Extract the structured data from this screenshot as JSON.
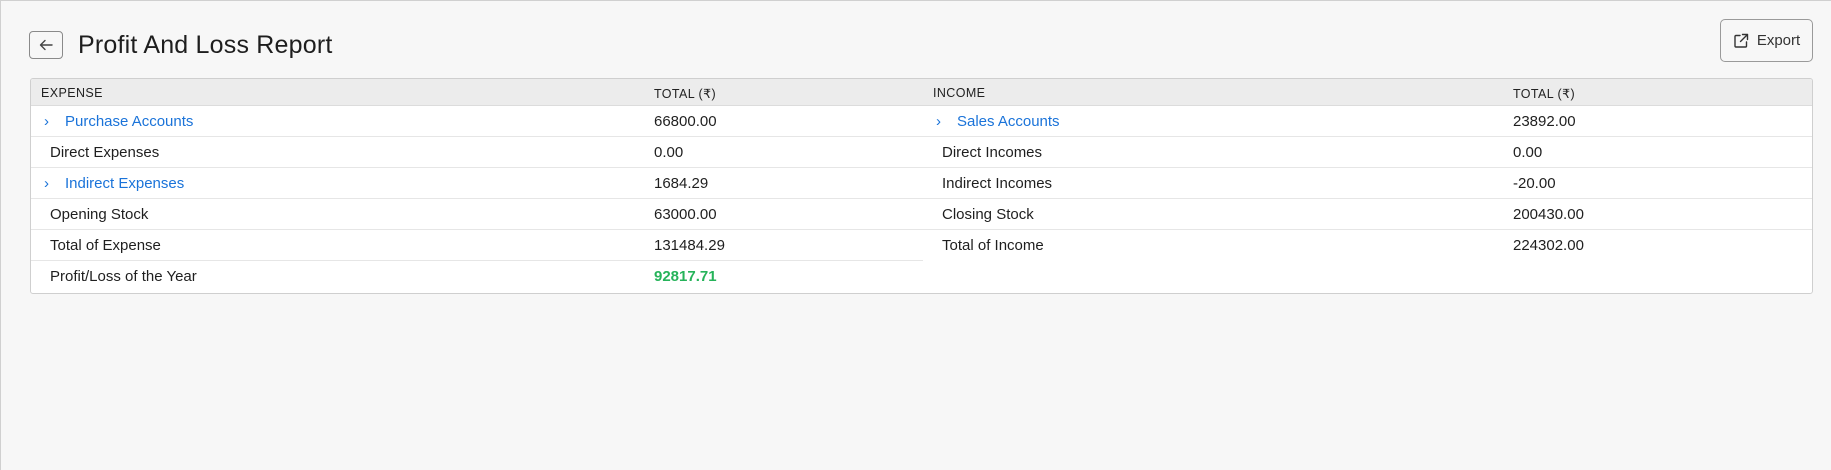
{
  "page": {
    "title": "Profit And Loss Report",
    "export_label": "Export"
  },
  "table": {
    "expense_header": "EXPENSE",
    "expense_total_header": "TOTAL (₹)",
    "income_header": "INCOME",
    "income_total_header": "TOTAL (₹)",
    "expense_rows": [
      {
        "label": "Purchase Accounts",
        "value": "66800.00"
      },
      {
        "label": "Direct Expenses",
        "value": "0.00"
      },
      {
        "label": "Indirect Expenses",
        "value": "1684.29"
      },
      {
        "label": "Opening Stock",
        "value": "63000.00"
      },
      {
        "label": "Total of Expense",
        "value": "131484.29"
      },
      {
        "label": "Profit/Loss of the Year",
        "value": "92817.71"
      }
    ],
    "income_rows": [
      {
        "label": "Sales Accounts",
        "value": "23892.00"
      },
      {
        "label": "Direct Incomes",
        "value": "0.00"
      },
      {
        "label": "Indirect Incomes",
        "value": "-20.00"
      },
      {
        "label": "Closing Stock",
        "value": "200430.00"
      },
      {
        "label": "Total of Income",
        "value": "224302.00"
      }
    ]
  },
  "colors": {
    "link": "#1a73d9",
    "profit": "#26b35a",
    "header_bg": "#ececec"
  },
  "icons": {
    "back": "arrow-left-icon",
    "export": "export-icon",
    "expand": "chevron-right-icon"
  }
}
